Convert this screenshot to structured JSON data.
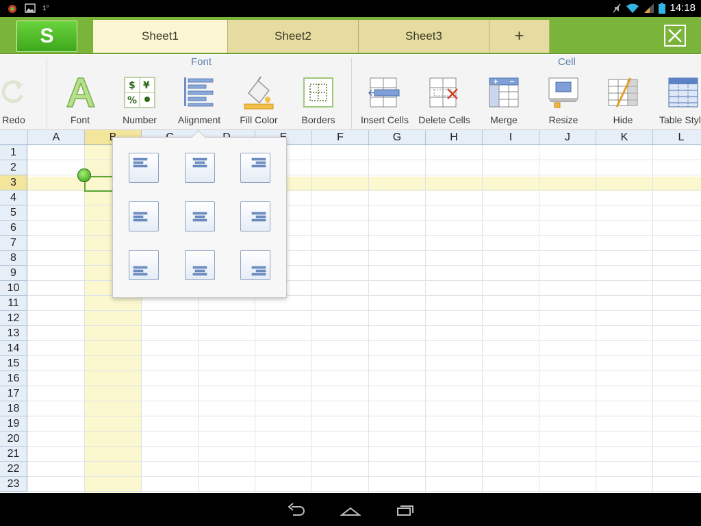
{
  "status_bar": {
    "notif_text": "1°",
    "time": "14:18",
    "icons": [
      "app-notification-icon",
      "image-icon",
      "mute-icon",
      "wifi-icon",
      "signal-icon",
      "battery-icon"
    ]
  },
  "header": {
    "app_logo": "S",
    "tabs": [
      "Sheet1",
      "Sheet2",
      "Sheet3"
    ],
    "add_tab": "+",
    "active_tab": "Sheet1",
    "accent": "#7bb43a"
  },
  "ribbon": {
    "groups": {
      "font": "Font",
      "cell": "Cell"
    },
    "buttons": {
      "redo": "Redo",
      "font": "Font",
      "number": "Number",
      "alignment": "Alignment",
      "fill_color": "Fill Color",
      "borders": "Borders",
      "insert_cells": "Insert Cells",
      "delete_cells": "Delete Cells",
      "merge": "Merge",
      "resize": "Resize",
      "hide": "Hide",
      "table_style": "Table Styl"
    },
    "number_glyphs": {
      "dollar": "$",
      "yen": "¥",
      "percent": "%"
    }
  },
  "sheet": {
    "columns": [
      "A",
      "B",
      "C",
      "D",
      "E",
      "F",
      "G",
      "H",
      "I",
      "J",
      "K",
      "L"
    ],
    "rows": [
      "1",
      "2",
      "3",
      "4",
      "5",
      "6",
      "7",
      "8",
      "9",
      "10",
      "11",
      "12",
      "13",
      "14",
      "15",
      "16",
      "17",
      "18",
      "19",
      "20",
      "21",
      "22",
      "23"
    ],
    "selected_cell": "B3",
    "highlight_color": "#fbf7cf"
  },
  "alignment_popup": {
    "options": [
      "top-left",
      "top-center",
      "top-right",
      "middle-left",
      "middle-center",
      "middle-right",
      "bottom-left",
      "bottom-center",
      "bottom-right"
    ]
  }
}
